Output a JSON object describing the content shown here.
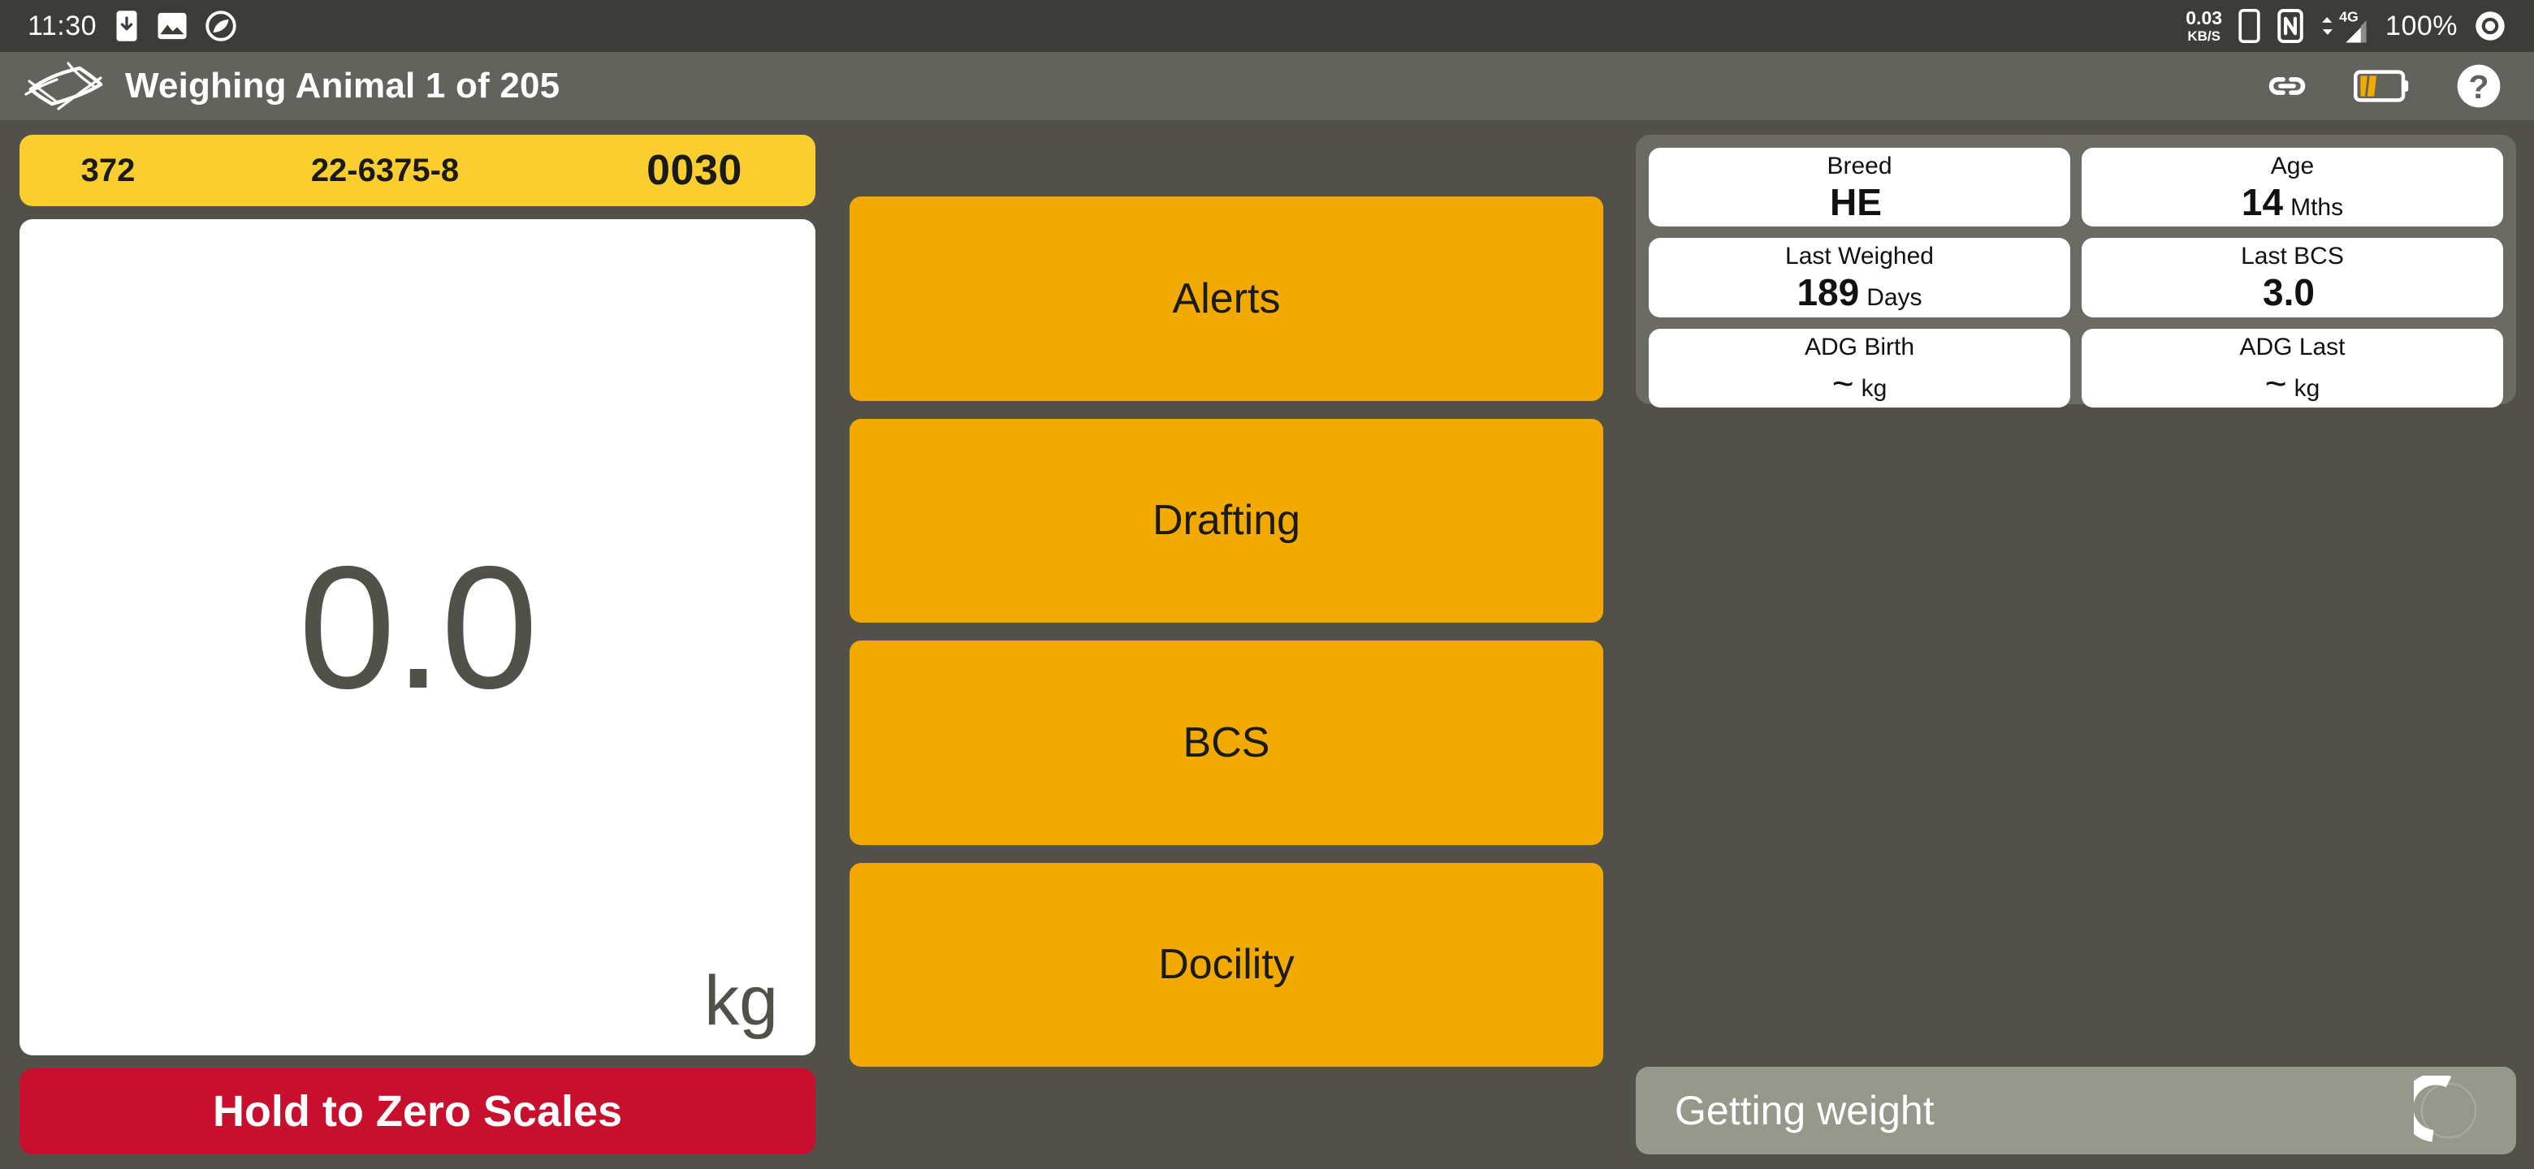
{
  "status_bar": {
    "time": "11:30",
    "network_rate": "0.03",
    "network_unit": "KB/S",
    "battery_percent": "100%",
    "icons": [
      "phone-download-icon",
      "image-icon",
      "do-not-disturb-icon",
      "phone-icon",
      "nfc-icon",
      "signal-4g-icon",
      "battery-circle-icon"
    ],
    "signal_label": "4G"
  },
  "app_bar": {
    "title": "Weighing Animal 1 of 205",
    "logo_name": "gallagher-diamond-logo",
    "actions": [
      {
        "name": "link-icon"
      },
      {
        "name": "scale-battery-icon"
      },
      {
        "name": "help-icon"
      }
    ]
  },
  "animal_id": {
    "visual_tag": "372",
    "eid": "22-6375-8",
    "vid": "0030"
  },
  "weight": {
    "value": "0.0",
    "unit": "kg"
  },
  "zero_button": {
    "label": "Hold to Zero Scales"
  },
  "actions": [
    {
      "label": "Alerts"
    },
    {
      "label": "Drafting"
    },
    {
      "label": "BCS"
    },
    {
      "label": "Docility"
    }
  ],
  "info_cards": [
    {
      "label": "Breed",
      "value": "HE",
      "unit": ""
    },
    {
      "label": "Age",
      "value": "14",
      "unit": "Mths"
    },
    {
      "label": "Last Weighed",
      "value": "189",
      "unit": "Days"
    },
    {
      "label": "Last BCS",
      "value": "3.0",
      "unit": ""
    },
    {
      "label": "ADG Birth",
      "value": "~",
      "unit": "kg"
    },
    {
      "label": "ADG Last",
      "value": "~",
      "unit": "kg"
    }
  ],
  "status_panel": {
    "text": "Getting weight",
    "spinner_name": "loading-spinner"
  },
  "colors": {
    "page_background": "#51514A",
    "status_bar_background": "#3C3D38",
    "app_bar_background": "#63635D",
    "id_bar_yellow": "#FBCE2F",
    "action_orange": "#F2A900",
    "zero_red": "#C8102E",
    "info_panel_gray": "#6B6B64",
    "status_panel_gray": "#97988C",
    "card_white": "#FFFFFF"
  }
}
